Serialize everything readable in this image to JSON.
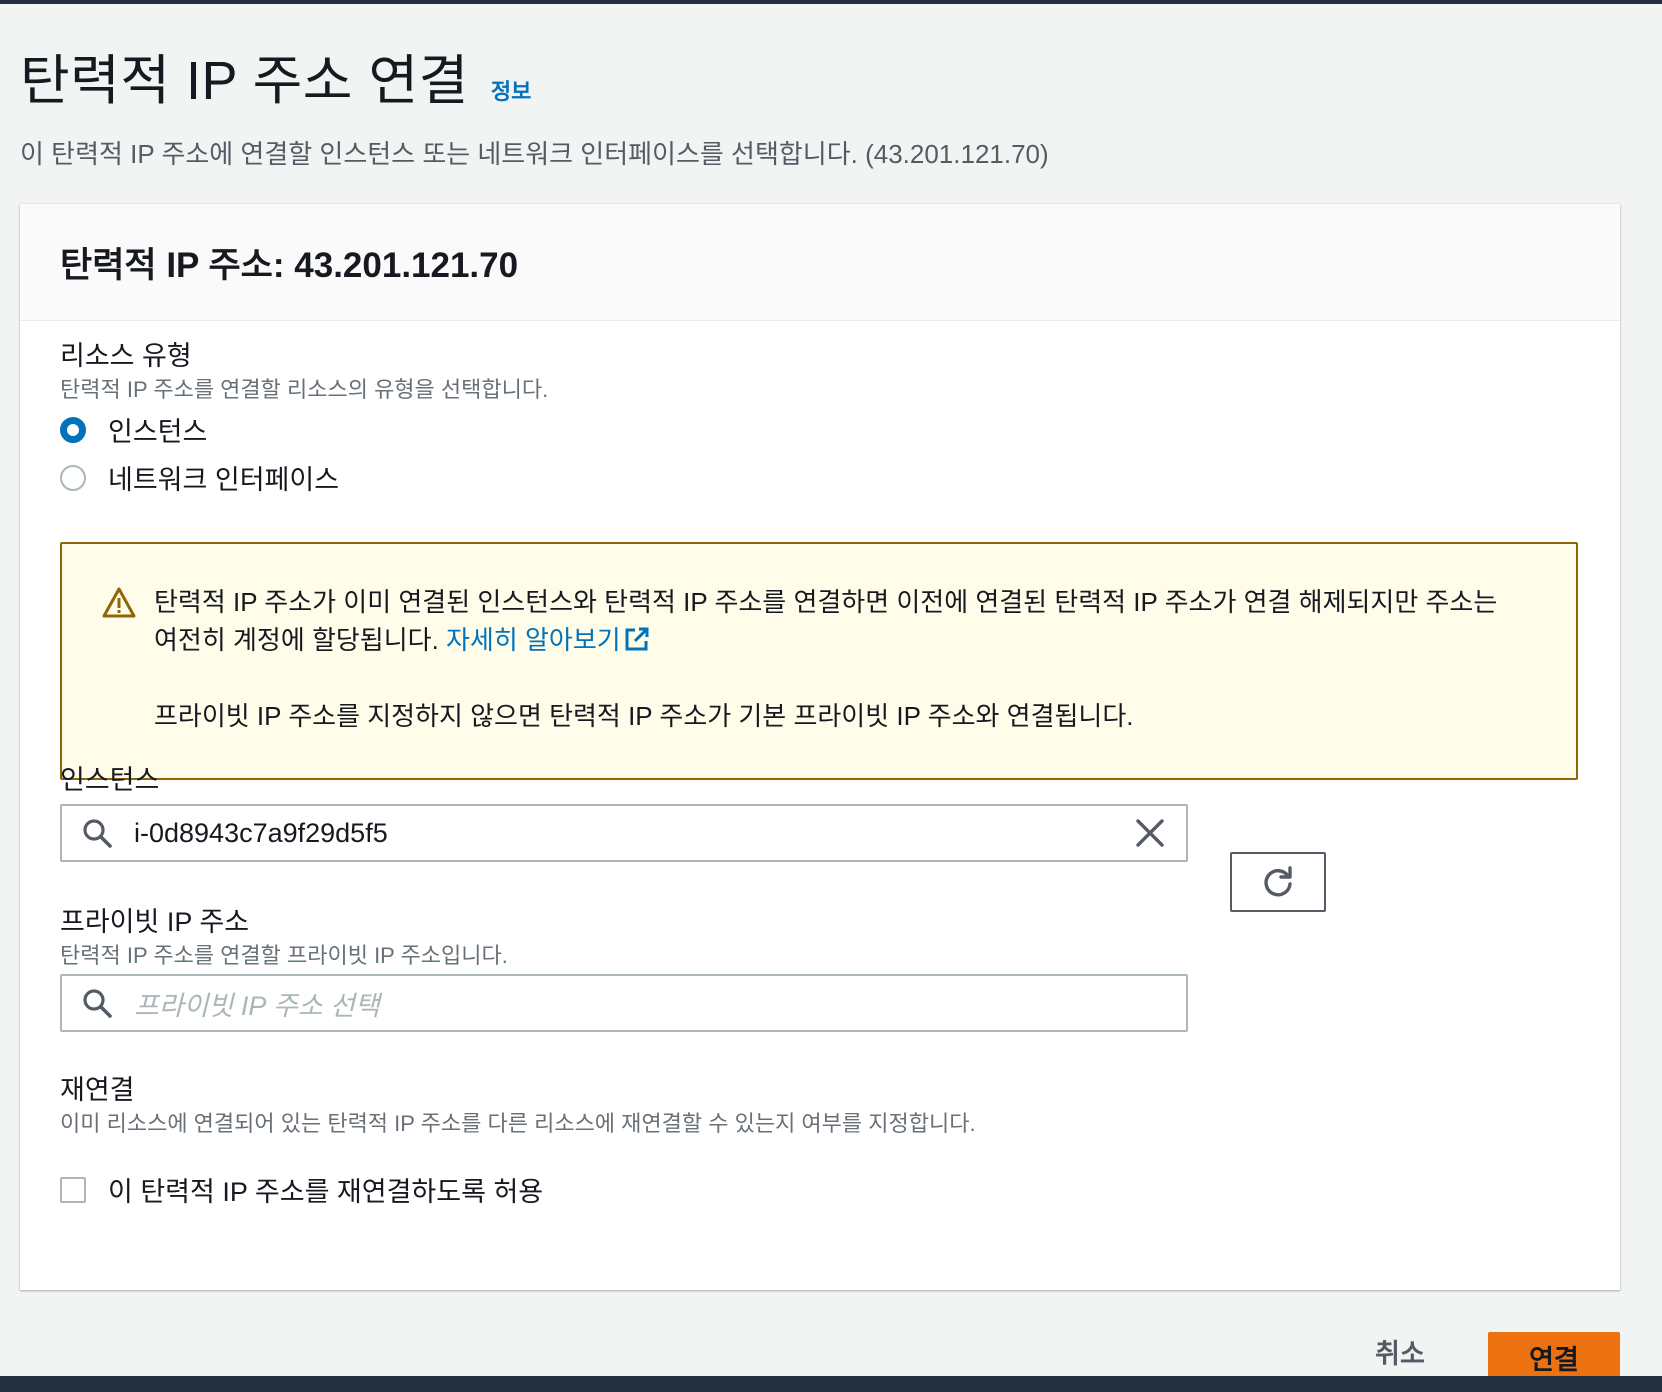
{
  "page": {
    "title": "탄력적 IP 주소 연결",
    "info_link": "정보",
    "description": "이 탄력적 IP 주소에 연결할 인스턴스 또는 네트워크 인터페이스를 선택합니다. (43.201.121.70)"
  },
  "container": {
    "title": "탄력적 IP 주소: 43.201.121.70"
  },
  "resource_type": {
    "label": "리소스 유형",
    "description": "탄력적 IP 주소를 연결할 리소스의 유형을 선택합니다.",
    "options": [
      {
        "label": "인스턴스",
        "selected": true
      },
      {
        "label": "네트워크 인터페이스",
        "selected": false
      }
    ]
  },
  "alert": {
    "line1": "탄력적 IP 주소가 이미 연결된 인스턴스와 탄력적 IP 주소를 연결하면 이전에 연결된 탄력적 IP 주소가 연결 해제되지만 주소는",
    "line2_prefix": "여전히 계정에 할당됩니다. ",
    "link": "자세히 알아보기",
    "line3": "프라이빗 IP 주소를 지정하지 않으면 탄력적 IP 주소가 기본 프라이빗 IP 주소와 연결됩니다.",
    "icon": "warning-icon",
    "colors": {
      "background": "#fffce9",
      "border": "#8d6605"
    }
  },
  "instance": {
    "label": "인스턴스",
    "value": "i-0d8943c7a9f29d5f5"
  },
  "private_ip": {
    "label": "프라이빗 IP 주소",
    "description": "탄력적 IP 주소를 연결할 프라이빗 IP 주소입니다.",
    "placeholder": "프라이빗 IP 주소 선택"
  },
  "reassociate": {
    "label": "재연결",
    "description": "이미 리소스에 연결되어 있는 탄력적 IP 주소를 다른 리소스에 재연결할 수 있는지 여부를 지정합니다.",
    "checkbox_label": "이 탄력적 IP 주소를 재연결하도록 허용",
    "checked": false
  },
  "actions": {
    "cancel": "취소",
    "submit": "연결"
  },
  "colors": {
    "accent": "#0073bb",
    "primary_button": "#ec7211",
    "background": "#f2f3f3"
  }
}
